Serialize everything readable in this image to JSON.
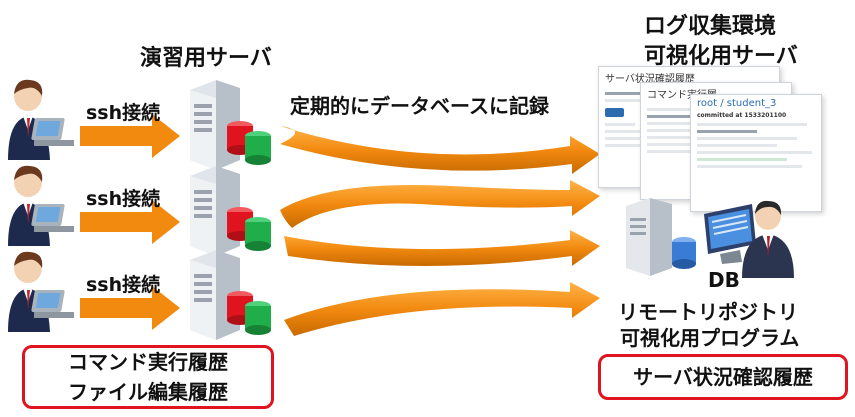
{
  "labels": {
    "server_title": "演習用サーバ",
    "record_label": "定期的にデータベースに記録",
    "log_env_line1": "ログ収集環境",
    "log_env_line2": "可視化用サーバ",
    "ssh_labels": [
      "ssh接続",
      "ssh接続",
      "ssh接続"
    ],
    "db": "DB",
    "remote_repo": "リモートリポジトリ",
    "viz_program": "可視化用プログラム"
  },
  "history_box": {
    "line1": "コマンド実行履歴",
    "line2": "ファイル編集履歴"
  },
  "status_box": {
    "text": "サーバ状況確認履歴"
  },
  "screenshots": {
    "back_title": "サーバ状況確認履歴",
    "mid_title": "コマンド実行履",
    "front_title": "root / student_3",
    "front_commit": "committed at 1533201100"
  },
  "colors": {
    "arrow": "#f28a10",
    "box_border": "#e0141e",
    "db_red": "#e0141e",
    "db_green": "#1fae4a",
    "db_blue": "#3a7bd5"
  }
}
